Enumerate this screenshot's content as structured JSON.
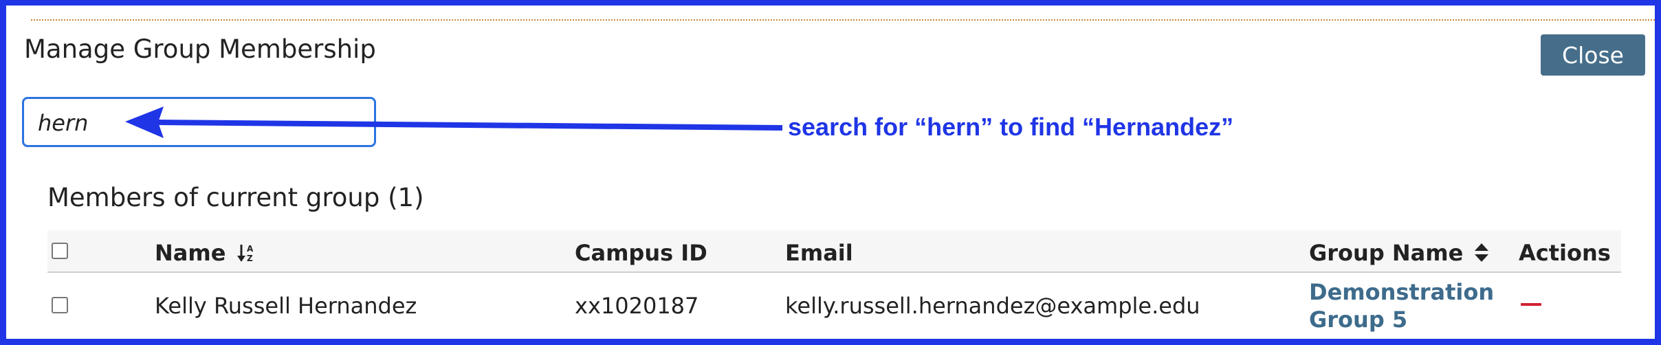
{
  "dialog": {
    "title": "Manage Group Membership",
    "close_label": "Close"
  },
  "search": {
    "value": "hern"
  },
  "annotation": {
    "text": "search for “hern” to find “Hernandez”",
    "color": "#1f35e6"
  },
  "members": {
    "heading": "Members of current group (1)",
    "columns": {
      "name": "Name",
      "campus_id": "Campus ID",
      "email": "Email",
      "group_name": "Group Name",
      "actions": "Actions"
    },
    "rows": [
      {
        "name": "Kelly Russell Hernandez",
        "campus_id": "xx1020187",
        "email": "kelly.russell.hernandez@example.edu",
        "group_name": "Demonstration Group 5"
      }
    ]
  },
  "colors": {
    "accent": "#466e8a",
    "link": "#3d6b8c",
    "remove": "#d0212f",
    "frame": "#1f35e6"
  },
  "icons": {
    "sort_name": "sort-alpha-down-icon",
    "sort_group": "sort-icon",
    "remove": "minus-icon"
  }
}
